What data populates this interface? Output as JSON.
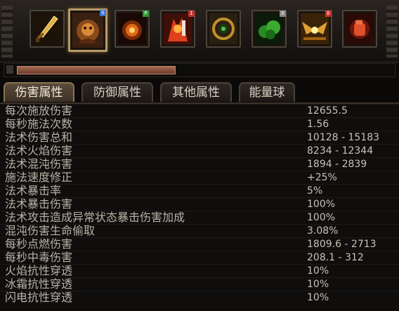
{
  "skill_bar": {
    "slots": [
      {
        "name": "golden-sword",
        "key": ""
      },
      {
        "name": "flame-skull-portrait",
        "key": "G",
        "key_color": "#3a78d8"
      },
      {
        "name": "fire-burst",
        "key": "P",
        "key_color": "#2d9a3a"
      },
      {
        "name": "fire-demon",
        "key": "I",
        "key_color": "#c43030"
      },
      {
        "name": "rune-circle",
        "key": ""
      },
      {
        "name": "green-poison-cloud",
        "key": "X",
        "key_color": "#888888"
      },
      {
        "name": "golden-wings",
        "key": "D",
        "key_color": "#c43030"
      },
      {
        "name": "red-fist",
        "key": ""
      }
    ]
  },
  "experience_bar": {
    "fill_fraction": 0.42
  },
  "tabs": [
    "伤害属性",
    "防御属性",
    "其他属性",
    "能量球"
  ],
  "active_tab": "伤害属性",
  "stats": [
    {
      "label": "每次施放伤害",
      "value": "12655.5"
    },
    {
      "label": "每秒施法次数",
      "value": "1.56"
    },
    {
      "label": "法术伤害总和",
      "value": "10128 - 15183"
    },
    {
      "label": "法术火焰伤害",
      "value": "8234 - 12344"
    },
    {
      "label": "法术混沌伤害",
      "value": "1894 - 2839"
    },
    {
      "label": "施法速度修正",
      "value": "+25%"
    },
    {
      "label": "法术暴击率",
      "value": "5%"
    },
    {
      "label": "法术暴击伤害",
      "value": "100%"
    },
    {
      "label": "法术攻击造成异常状态暴击伤害加成",
      "value": "100%"
    },
    {
      "label": "混沌伤害生命偷取",
      "value": "3.08%"
    },
    {
      "label": "每秒点燃伤害",
      "value": "1809.6 - 2713"
    },
    {
      "label": "每秒中毒伤害",
      "value": "208.1 - 312"
    },
    {
      "label": "火焰抗性穿透",
      "value": "10%"
    },
    {
      "label": "冰霜抗性穿透",
      "value": "10%"
    },
    {
      "label": "闪电抗性穿透",
      "value": "10%"
    }
  ]
}
